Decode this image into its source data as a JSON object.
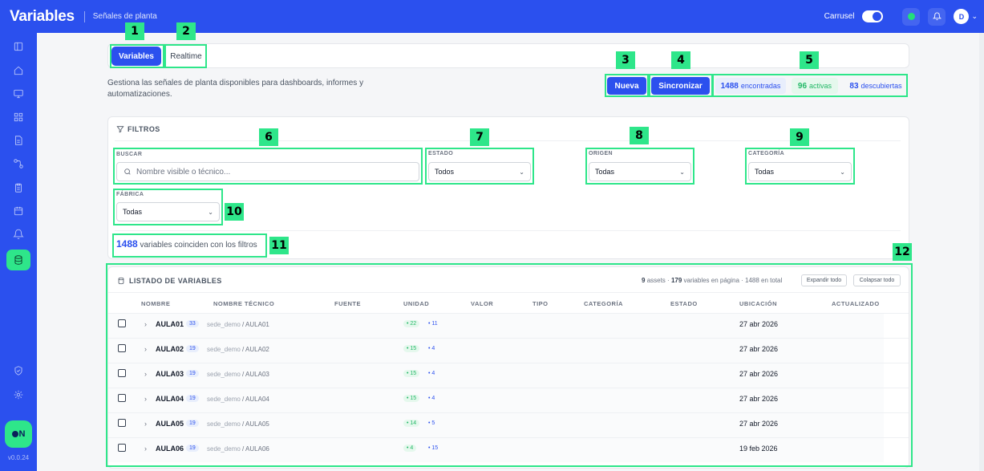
{
  "app": {
    "brand": "Variables",
    "subtitle": "Señales de planta",
    "carrusel_label": "Carrusel",
    "avatar_initial": "D",
    "version": "v0.0.24",
    "logo_text": "N"
  },
  "tabs": [
    {
      "label": "Variables",
      "active": true
    },
    {
      "label": "Realtime",
      "active": false
    }
  ],
  "description": "Gestiona las señales de planta disponibles para dashboards, informes y automatizaciones.",
  "actions": {
    "new_label": "Nueva",
    "sync_label": "Sincronizar"
  },
  "counters": {
    "found_value": "1488",
    "found_label": "encontradas",
    "active_value": "96",
    "active_label": "activas",
    "discovered_value": "83",
    "discovered_label": "descubiertas"
  },
  "filters": {
    "title": "FILTROS",
    "search_label": "BUSCAR",
    "search_placeholder": "Nombre visible o técnico...",
    "estado_label": "ESTADO",
    "estado_value": "Todos",
    "origen_label": "ORIGEN",
    "origen_value": "Todas",
    "categoria_label": "CATEGORÍA",
    "categoria_value": "Todas",
    "fabrica_label": "FÁBRICA",
    "fabrica_value": "Todas"
  },
  "results": {
    "count": "1488",
    "text": "variables coinciden con los filtros"
  },
  "listing": {
    "title": "LISTADO DE VARIABLES",
    "assets_count": "9",
    "assets_label": "assets ·",
    "page_count": "179",
    "page_label": "variables en página · 1488 en total",
    "expand_all": "Expandir todo",
    "collapse_all": "Colapsar todo",
    "columns": [
      "NOMBRE",
      "NOMBRE TÉCNICO",
      "FUENTE",
      "UNIDAD",
      "VALOR",
      "TIPO",
      "CATEGORÍA",
      "ESTADO",
      "UBICACIÓN",
      "ACTUALIZADO"
    ],
    "rows": [
      {
        "name": "AULA01",
        "count": "33",
        "tech_prefix": "sede_demo",
        "tech": "/ AULA01",
        "green": "22",
        "blue": "11",
        "date": "27 abr 2026"
      },
      {
        "name": "AULA02",
        "count": "19",
        "tech_prefix": "sede_demo",
        "tech": "/ AULA02",
        "green": "15",
        "blue": "4",
        "date": "27 abr 2026"
      },
      {
        "name": "AULA03",
        "count": "19",
        "tech_prefix": "sede_demo",
        "tech": "/ AULA03",
        "green": "15",
        "blue": "4",
        "date": "27 abr 2026"
      },
      {
        "name": "AULA04",
        "count": "19",
        "tech_prefix": "sede_demo",
        "tech": "/ AULA04",
        "green": "15",
        "blue": "4",
        "date": "27 abr 2026"
      },
      {
        "name": "AULA05",
        "count": "19",
        "tech_prefix": "sede_demo",
        "tech": "/ AULA05",
        "green": "14",
        "blue": "5",
        "date": "27 abr 2026"
      },
      {
        "name": "AULA06",
        "count": "19",
        "tech_prefix": "sede_demo",
        "tech": "/ AULA06",
        "green": "4",
        "blue": "15",
        "date": "19 feb 2026"
      }
    ]
  },
  "annotations": [
    "1",
    "2",
    "3",
    "4",
    "5",
    "6",
    "7",
    "8",
    "9",
    "10",
    "11",
    "12"
  ],
  "colors": {
    "brand_blue": "#2b50ee",
    "accent_green": "#2ee68a"
  }
}
